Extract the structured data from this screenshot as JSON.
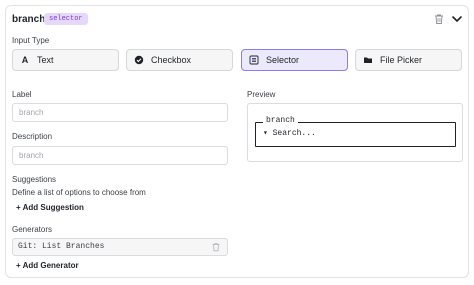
{
  "header": {
    "title": "branch",
    "badge": "selector"
  },
  "input_type": {
    "label": "Input Type",
    "options": [
      {
        "label": "Text",
        "icon": "text-a-icon"
      },
      {
        "label": "Checkbox",
        "icon": "check-circle-icon"
      },
      {
        "label": "Selector",
        "icon": "list-icon",
        "selected": true
      },
      {
        "label": "File Picker",
        "icon": "folder-icon"
      }
    ]
  },
  "label_field": {
    "label": "Label",
    "placeholder": "branch"
  },
  "description_field": {
    "label": "Description",
    "placeholder": "branch"
  },
  "suggestions": {
    "label": "Suggestions",
    "help": "Define a list of options to choose from",
    "add_label": "+ Add Suggestion"
  },
  "generators": {
    "label": "Generators",
    "items": [
      "Git: List Branches"
    ],
    "add_label": "+ Add Generator"
  },
  "preview": {
    "label": "Preview",
    "legend": "branch",
    "selector_text": "▾ Search..."
  },
  "colors": {
    "accent": "#8a7ef0",
    "badge_bg": "#e6d8fb",
    "badge_text": "#7a3fd1"
  }
}
